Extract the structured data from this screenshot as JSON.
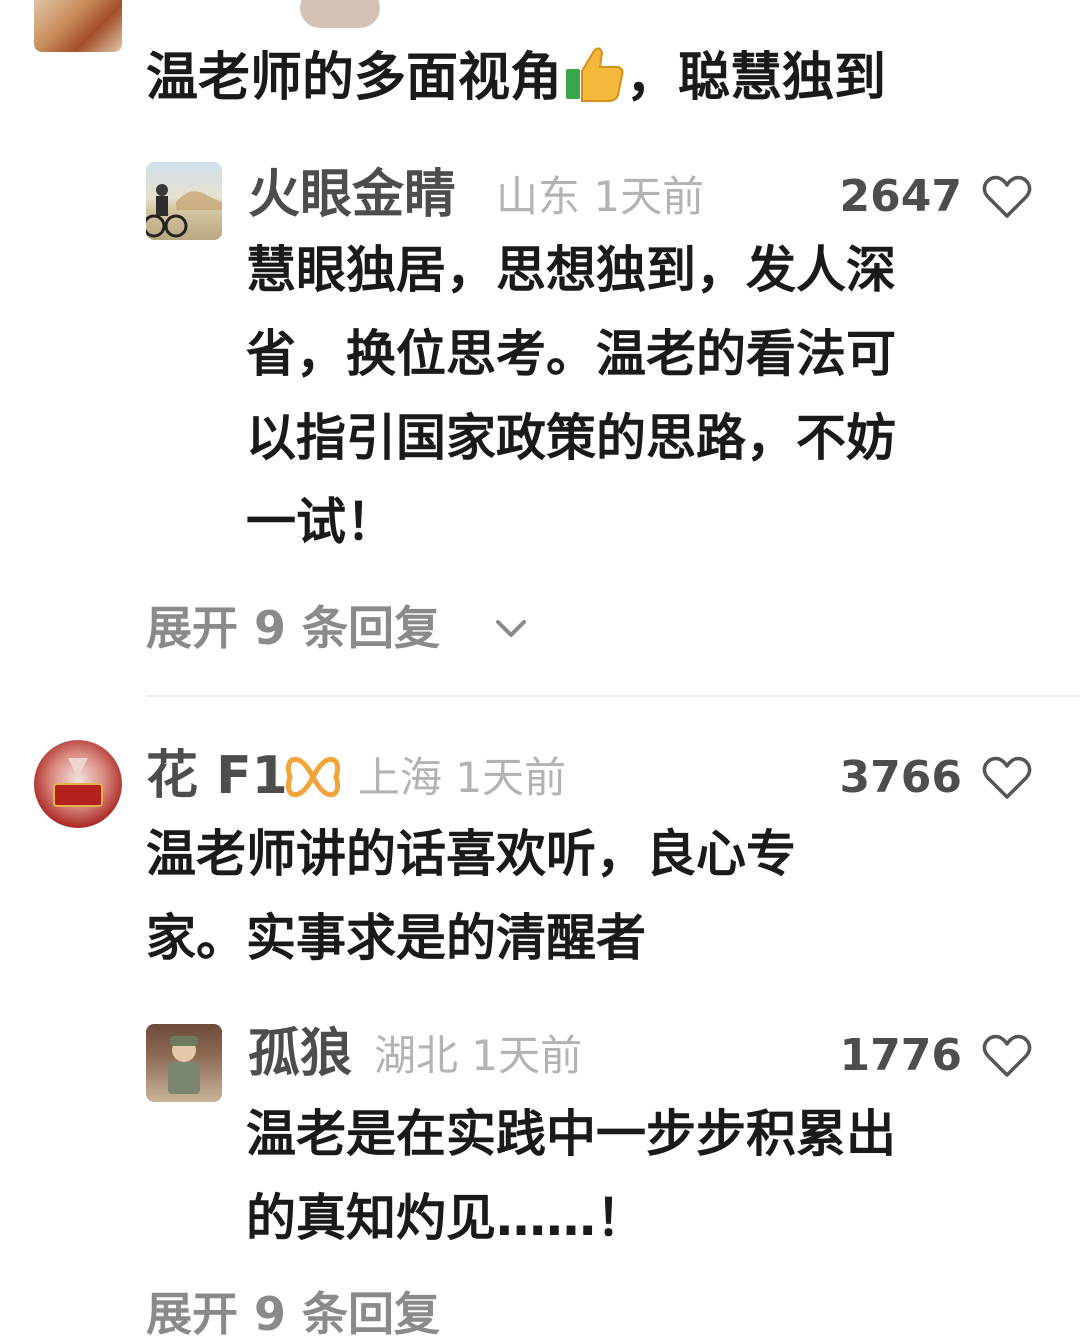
{
  "comment_top": {
    "text_before_emoji": "温老师的多面视角",
    "emoji_icon": "thumbs-up-icon",
    "text_after_emoji": "，聪慧独到",
    "reply": {
      "username": "火眼金睛",
      "location": "山东",
      "time": "1天前",
      "likes": "2647",
      "lines": [
        "慧眼独居，思想独到，发人深",
        "省，换位思考。温老的看法可",
        "以指引国家政策的思路，不妨",
        "一试！"
      ]
    },
    "expand_label": "展开 9 条回复"
  },
  "comment_second": {
    "username": "花 F1",
    "badge_icon": "bow-badge-icon",
    "location": "上海",
    "time": "1天前",
    "likes": "3766",
    "lines": [
      "温老师讲的话喜欢听，良心专",
      "家。实事求是的清醒者"
    ],
    "reply": {
      "username": "孤狼",
      "location": "湖北",
      "time": "1天前",
      "likes": "1776",
      "lines": [
        "温老是在实践中一步步积累出",
        "的真知灼见……！"
      ]
    },
    "expand_label": "展开 9 条回复"
  },
  "colors": {
    "username": "#4d4d4d",
    "meta": "#b3b3b3",
    "text": "#1a1a1a",
    "expand": "#8a8a8a",
    "badge": "#f2a33a"
  }
}
